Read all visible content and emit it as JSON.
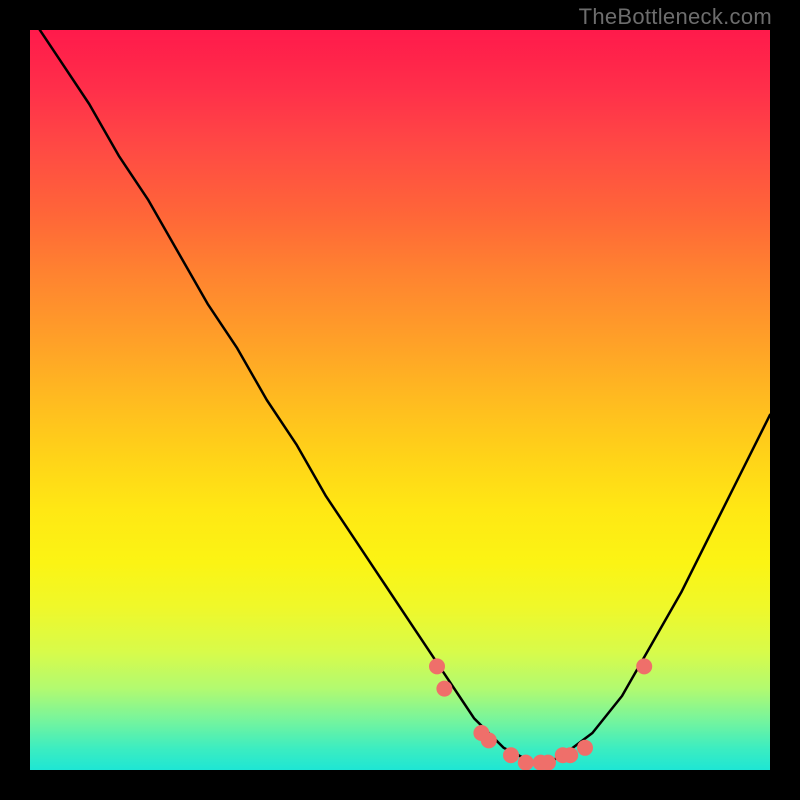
{
  "watermark": "TheBottleneck.com",
  "chart_data": {
    "type": "line",
    "title": "",
    "xlabel": "",
    "ylabel": "",
    "xlim": [
      0,
      100
    ],
    "ylim": [
      0,
      100
    ],
    "grid": false,
    "series": [
      {
        "name": "bottleneck-curve",
        "color": "#000000",
        "x": [
          0,
          4,
          8,
          12,
          16,
          20,
          24,
          28,
          32,
          36,
          40,
          44,
          48,
          52,
          56,
          58,
          60,
          62,
          64,
          66,
          68,
          70,
          72,
          76,
          80,
          84,
          88,
          92,
          96,
          100
        ],
        "y": [
          102,
          96,
          90,
          83,
          77,
          70,
          63,
          57,
          50,
          44,
          37,
          31,
          25,
          19,
          13,
          10,
          7,
          5,
          3,
          2,
          1,
          1,
          2,
          5,
          10,
          17,
          24,
          32,
          40,
          48
        ]
      }
    ],
    "markers": {
      "name": "highlight-points",
      "shape": "circle",
      "color": "#ef6f6a",
      "radius_px": 8,
      "x": [
        55,
        56,
        61,
        62,
        65,
        67,
        69,
        70,
        72,
        73,
        75,
        83
      ],
      "y": [
        14,
        11,
        5,
        4,
        2,
        1,
        1,
        1,
        2,
        2,
        3,
        14
      ]
    },
    "gradient_stops": [
      {
        "pct": 0,
        "color": "#ff1a4b"
      },
      {
        "pct": 25,
        "color": "#ff6638"
      },
      {
        "pct": 50,
        "color": "#ffbb20"
      },
      {
        "pct": 75,
        "color": "#eff82a"
      },
      {
        "pct": 100,
        "color": "#1ee6d4"
      }
    ]
  }
}
